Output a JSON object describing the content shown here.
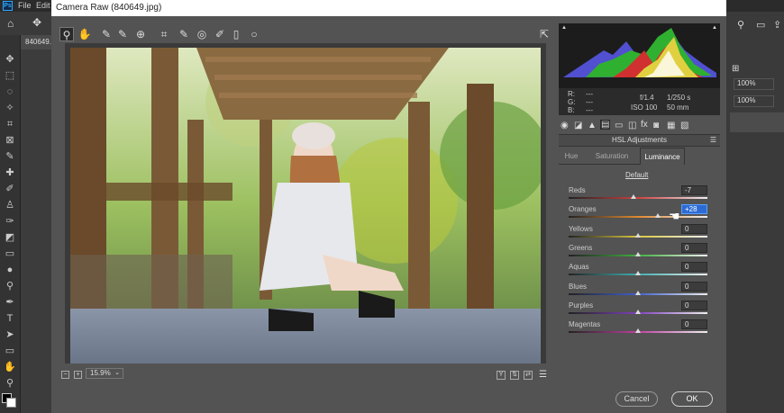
{
  "ps": {
    "logo": "Ps",
    "menus": [
      "File",
      "Edit"
    ],
    "doc_tab": "840649.",
    "right_zoom": [
      "100%",
      "100%"
    ]
  },
  "dialog": {
    "title": "Camera Raw (840649.jpg)",
    "zoom_value": "15.9%",
    "readout": {
      "r_label": "R:",
      "g_label": "G:",
      "b_label": "B:",
      "r": "---",
      "g": "---",
      "b": "---",
      "aperture": "f/1.4",
      "shutter": "1/250 s",
      "iso": "ISO 100",
      "focal": "50 mm"
    },
    "panel_title": "HSL Adjustments",
    "tabs": [
      "Hue",
      "Saturation",
      "Luminance"
    ],
    "active_tab": "Luminance",
    "default_label": "Default",
    "sliders": [
      {
        "label": "Reds",
        "value": "-7",
        "level": -7,
        "color": "#d04040"
      },
      {
        "label": "Oranges",
        "value": "+28",
        "level": 28,
        "color": "#e08a30"
      },
      {
        "label": "Yellows",
        "value": "0",
        "level": 0,
        "color": "#d8c840"
      },
      {
        "label": "Greens",
        "value": "0",
        "level": 0,
        "color": "#40b040"
      },
      {
        "label": "Aquas",
        "value": "0",
        "level": 0,
        "color": "#40b0b0"
      },
      {
        "label": "Blues",
        "value": "0",
        "level": 0,
        "color": "#4060d0"
      },
      {
        "label": "Purples",
        "value": "0",
        "level": 0,
        "color": "#8040c0"
      },
      {
        "label": "Magentas",
        "value": "0",
        "level": 0,
        "color": "#c040a0"
      }
    ],
    "cancel_label": "Cancel",
    "ok_label": "OK"
  }
}
